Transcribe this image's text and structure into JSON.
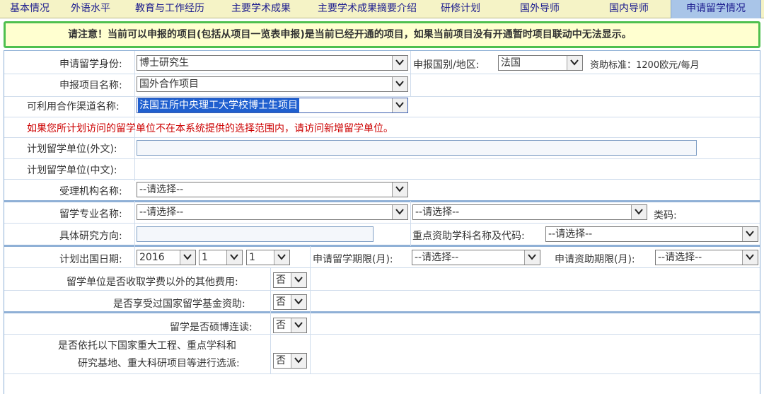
{
  "tabs": [
    {
      "label": "基本情况"
    },
    {
      "label": "外语水平"
    },
    {
      "label": "教育与工作经历"
    },
    {
      "label": "主要学术成果"
    },
    {
      "label": "主要学术成果摘要介绍"
    },
    {
      "label": "研修计划"
    },
    {
      "label": "国外导师"
    },
    {
      "label": "国内导师"
    },
    {
      "label": "申请留学情况"
    }
  ],
  "notice": "请注意！当前可以申报的项目(包括从项目一览表申报)是当前已经开通的项目，如果当前项目没有开通暂时项目联动中无法显示。",
  "form": {
    "identity": {
      "label": "申请留学身份:",
      "value": "博士研究生"
    },
    "country": {
      "label": "申报国别/地区:",
      "value": "法国"
    },
    "funding_standard": "资助标准：1200欧元/每月",
    "project_name": {
      "label": "申报项目名称:",
      "value": "国外合作项目"
    },
    "channel": {
      "label": "可利用合作渠道名称:",
      "value": "法国五所中央理工大学校博士生项目"
    },
    "warning": "如果您所计划访问的留学单位不在本系统提供的选择范围内，请访问新增留学单位。",
    "unit_foreign": {
      "label": "计划留学单位(外文):",
      "value": ""
    },
    "unit_chinese": {
      "label": "计划留学单位(中文):"
    },
    "agency": {
      "label": "受理机构名称:",
      "value": "--请选择--"
    },
    "major": {
      "label": "留学专业名称:",
      "value1": "--请选择--",
      "value2": "--请选择--"
    },
    "category_code": {
      "label": "类码:"
    },
    "research_direction": {
      "label": "具体研究方向:",
      "value": ""
    },
    "key_discipline": {
      "label": "重点资助学科名称及代码:",
      "value": "--请选择--"
    },
    "departure_date": {
      "label": "计划出国日期:",
      "year": "2016",
      "month": "1",
      "day": "1"
    },
    "study_duration": {
      "label": "申请留学期限(月):",
      "value": "--请选择--"
    },
    "funding_duration": {
      "label": "申请资助期限(月):",
      "value": "--请选择--"
    },
    "other_fees": {
      "label": "留学单位是否收取学费以外的其他费用:",
      "value": "否"
    },
    "csc_funded": {
      "label": "是否享受过国家留学基金资助:",
      "value": "否"
    },
    "master_phd": {
      "label": "留学是否硕博连读:",
      "value": "否"
    },
    "major_project": {
      "label_line1": "是否依托以下国家重大工程、重点学科和",
      "label_line2": "研究基地、重大科研项目等进行选派:",
      "value": "否"
    }
  }
}
